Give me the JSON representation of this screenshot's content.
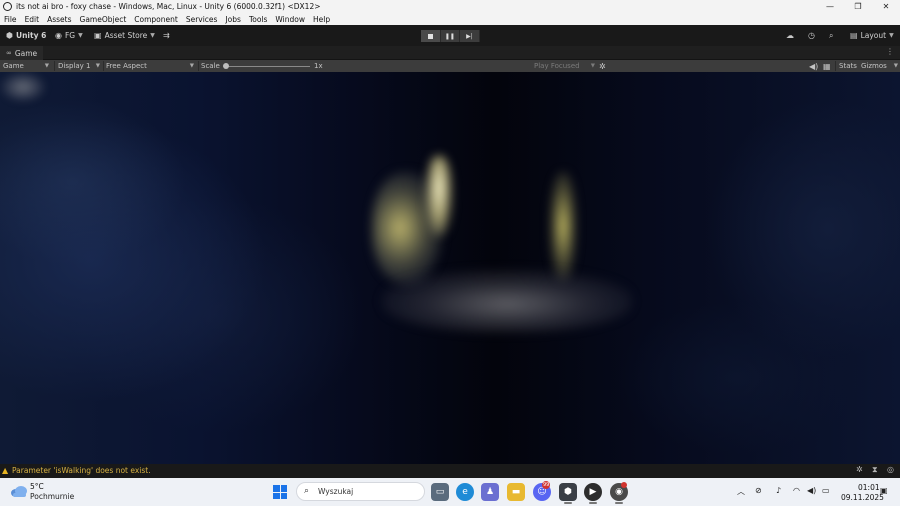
{
  "window": {
    "title": "its not ai bro - foxy chase - Windows, Mac, Linux - Unity 6 (6000.0.32f1) <DX12>",
    "minimize": "—",
    "maximize": "❐",
    "close": "✕"
  },
  "menu": [
    "File",
    "Edit",
    "Assets",
    "GameObject",
    "Component",
    "Services",
    "Jobs",
    "Tools",
    "Window",
    "Help"
  ],
  "toolbar": {
    "unity_label": "Unity 6",
    "account_label": "FG",
    "asset_store_label": "Asset Store",
    "layout_label": "Layout"
  },
  "tab": {
    "label": "Game"
  },
  "gamebar": {
    "view_mode": "Game",
    "display": "Display 1",
    "aspect": "Free Aspect",
    "scale_label": "Scale",
    "scale_value": "1x",
    "scale_fraction": 0.0,
    "play_mode": "Play Focused",
    "stats": "Stats",
    "gizmos": "Gizmos"
  },
  "status": {
    "message": "Parameter 'isWalking' does not exist."
  },
  "taskbar": {
    "weather_temp": "5°C",
    "weather_desc": "Pochmurnie",
    "search_placeholder": "Wyszukaj",
    "discord_badge": "99",
    "time": "01:01",
    "date": "09.11.2025"
  },
  "colors": {
    "warning": "#e6b422",
    "accent": "#1a73e8"
  }
}
